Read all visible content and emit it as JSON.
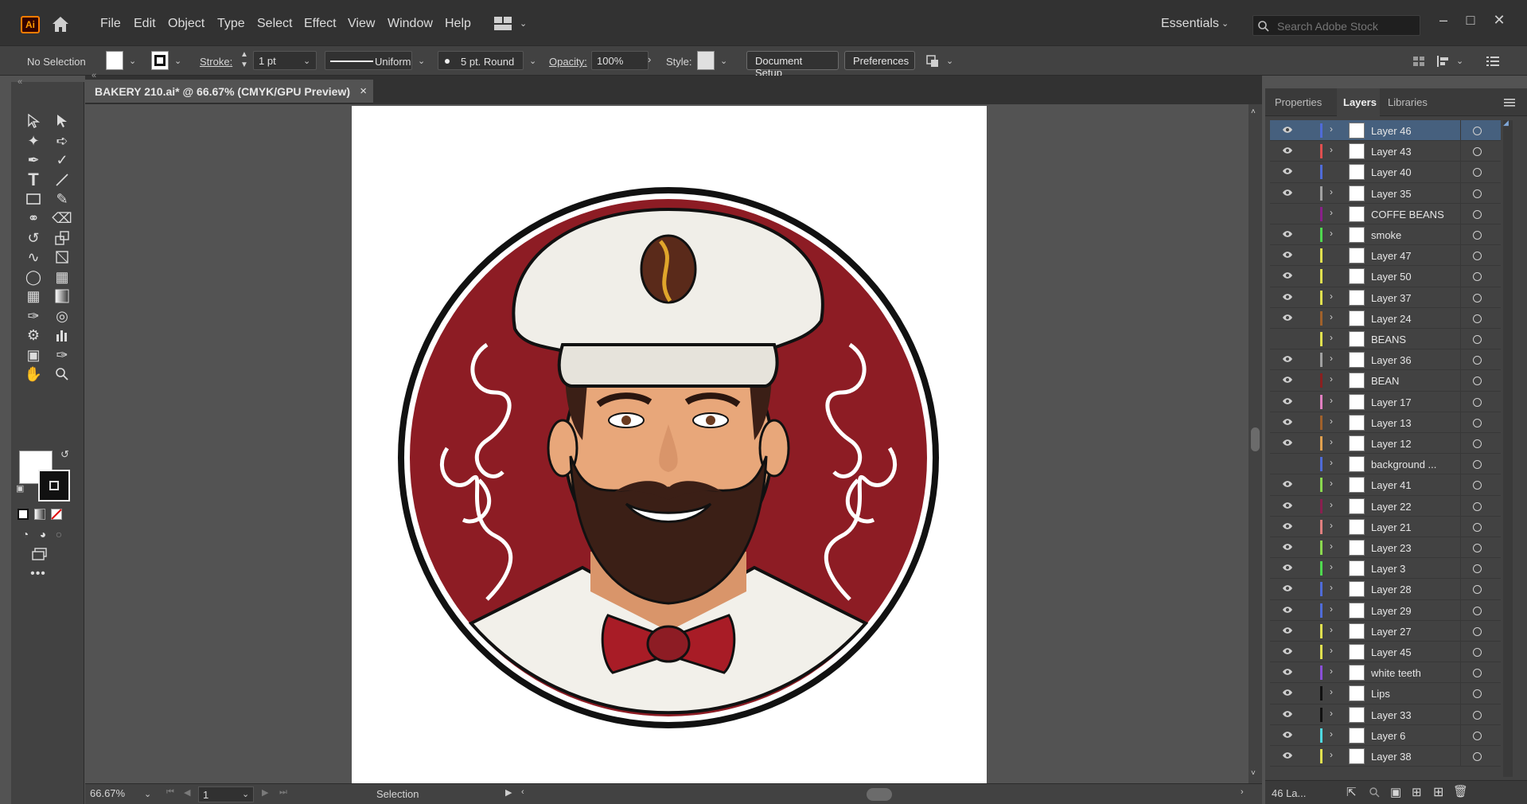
{
  "app": {
    "logo": "Ai",
    "menu": [
      "File",
      "Edit",
      "Object",
      "Type",
      "Select",
      "Effect",
      "View",
      "Window",
      "Help"
    ],
    "workspace": "Essentials",
    "search_placeholder": "Search Adobe Stock"
  },
  "control_bar": {
    "selection": "No Selection",
    "stroke_label": "Stroke:",
    "stroke_weight": "1 pt",
    "stroke_profile": "Uniform",
    "brush": "5 pt. Round",
    "opacity_label": "Opacity:",
    "opacity": "100%",
    "style_label": "Style:",
    "document_setup": "Document Setup",
    "preferences": "Preferences"
  },
  "document": {
    "tab_title": "BAKERY 210.ai* @ 66.67% (CMYK/GPU Preview)",
    "close": "×"
  },
  "status_bar": {
    "zoom": "66.67%",
    "artboard": "1",
    "mode": "Selection"
  },
  "panel": {
    "tabs": [
      "Properties",
      "Layers",
      "Libraries"
    ],
    "active_tab": "Layers",
    "layer_count": "46 La...",
    "layers": [
      {
        "name": "Layer 46",
        "visible": true,
        "color": "#4f6bd8",
        "expandable": true,
        "selected": true
      },
      {
        "name": "Layer 43",
        "visible": true,
        "color": "#e04f4f",
        "expandable": true
      },
      {
        "name": "Layer 40",
        "visible": true,
        "color": "#4f6bd8",
        "expandable": false
      },
      {
        "name": "Layer 35",
        "visible": true,
        "color": "#a0a0a0",
        "expandable": true
      },
      {
        "name": "COFFE BEANS",
        "visible": false,
        "color": "#8a1f8a",
        "expandable": true
      },
      {
        "name": "smoke",
        "visible": true,
        "color": "#4fd84f",
        "expandable": true
      },
      {
        "name": "Layer 47",
        "visible": true,
        "color": "#e0e04f",
        "expandable": false
      },
      {
        "name": "Layer 50",
        "visible": true,
        "color": "#e0e04f",
        "expandable": false
      },
      {
        "name": "Layer 37",
        "visible": true,
        "color": "#e0e04f",
        "expandable": true
      },
      {
        "name": "Layer 24",
        "visible": true,
        "color": "#a0612b",
        "expandable": true
      },
      {
        "name": "BEANS",
        "visible": false,
        "color": "#e0e04f",
        "expandable": true
      },
      {
        "name": "Layer 36",
        "visible": true,
        "color": "#a0a0a0",
        "expandable": true
      },
      {
        "name": "BEAN",
        "visible": true,
        "color": "#8a1f1f",
        "expandable": true
      },
      {
        "name": "Layer 17",
        "visible": true,
        "color": "#e07fc0",
        "expandable": true
      },
      {
        "name": "Layer 13",
        "visible": true,
        "color": "#a0612b",
        "expandable": true
      },
      {
        "name": "Layer 12",
        "visible": true,
        "color": "#e0a04f",
        "expandable": true
      },
      {
        "name": "background ...",
        "visible": false,
        "color": "#4f6bd8",
        "expandable": true
      },
      {
        "name": "Layer 41",
        "visible": true,
        "color": "#8ad84f",
        "expandable": true
      },
      {
        "name": "Layer 22",
        "visible": true,
        "color": "#8a1f4f",
        "expandable": true
      },
      {
        "name": "Layer 21",
        "visible": true,
        "color": "#e07f7f",
        "expandable": true
      },
      {
        "name": "Layer 23",
        "visible": true,
        "color": "#8ad84f",
        "expandable": true
      },
      {
        "name": "Layer 3",
        "visible": true,
        "color": "#4fd84f",
        "expandable": true
      },
      {
        "name": "Layer 28",
        "visible": true,
        "color": "#4f6bd8",
        "expandable": true
      },
      {
        "name": "Layer 29",
        "visible": true,
        "color": "#4f6bd8",
        "expandable": true
      },
      {
        "name": "Layer 27",
        "visible": true,
        "color": "#e0e04f",
        "expandable": true
      },
      {
        "name": "Layer 45",
        "visible": true,
        "color": "#e0e04f",
        "expandable": true
      },
      {
        "name": "white teeth",
        "visible": true,
        "color": "#8a4fd8",
        "expandable": true
      },
      {
        "name": "Lips",
        "visible": true,
        "color": "#111111",
        "expandable": true
      },
      {
        "name": "Layer 33",
        "visible": true,
        "color": "#111111",
        "expandable": true
      },
      {
        "name": "Layer 6",
        "visible": true,
        "color": "#4fd8e0",
        "expandable": true
      },
      {
        "name": "Layer 38",
        "visible": true,
        "color": "#e0e04f",
        "expandable": true
      }
    ]
  },
  "colors": {
    "accent": "#46607e",
    "artwork_red": "#8d1c24"
  }
}
